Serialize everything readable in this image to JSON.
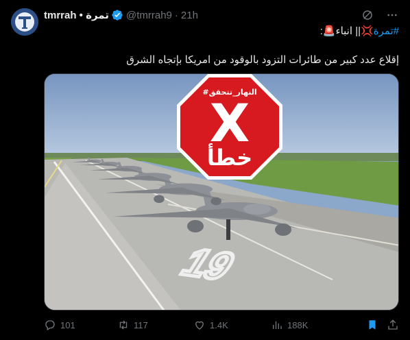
{
  "author": {
    "display_name": "tmrrah • تمرة",
    "handle": "@tmrrah9",
    "separator": "·",
    "time": "21h"
  },
  "tweet": {
    "line1_hashtag": "#تمرة",
    "line1_rest": "💢|| انباء🚨:",
    "line2": "إقلاع عدد كبير من طائرات التزود بالوقود من امريكا بإتجاه الشرق"
  },
  "media": {
    "stamp_hashtag": "#النهار_تتحقق",
    "stamp_word": "خطأ",
    "stamp_mark": "X",
    "runway_number": "19",
    "stamp_color": "#d71920"
  },
  "actions": {
    "replies": "101",
    "retweets": "117",
    "likes": "1.4K",
    "views": "188K"
  },
  "icons": [
    "avatar-logo",
    "verified-badge-icon",
    "grok-icon",
    "more-icon",
    "reply-icon",
    "retweet-icon",
    "like-icon",
    "views-icon",
    "bookmark-icon",
    "share-icon"
  ],
  "colors": {
    "accent": "#1d9bf0",
    "muted": "#71767b",
    "text": "#e7e9ea",
    "background": "#000000"
  }
}
